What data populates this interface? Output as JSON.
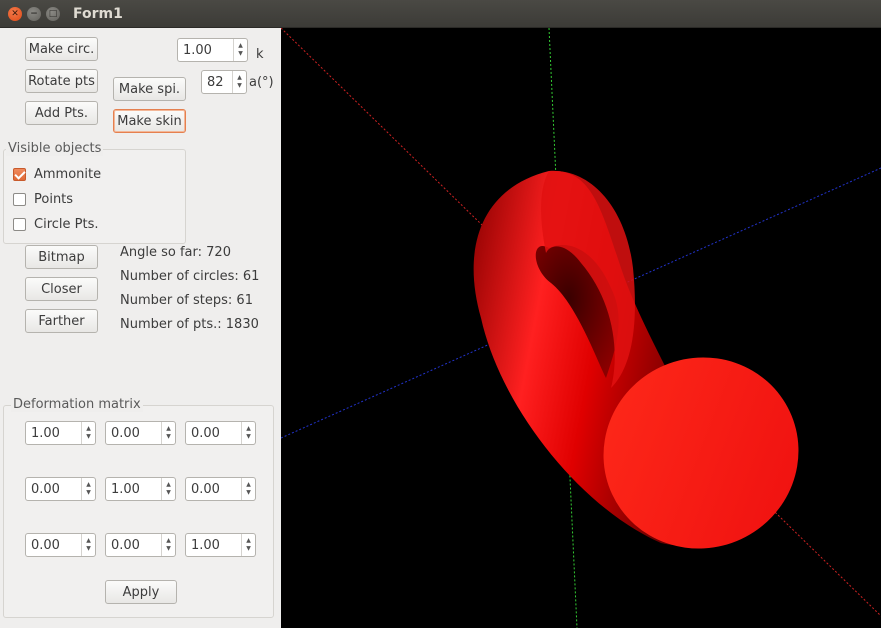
{
  "window": {
    "title": "Form1"
  },
  "buttons": {
    "make_circ": "Make circ.",
    "rotate_pts": "Rotate pts",
    "add_pts": "Add Pts.",
    "make_spi": "Make spi.",
    "make_skin": "Make skin",
    "bitmap": "Bitmap",
    "closer": "Closer",
    "farther": "Farther",
    "apply": "Apply"
  },
  "params": {
    "k_value": "1.00",
    "k_label": "k",
    "a_value": "82",
    "a_label": "a(°)"
  },
  "visible_objects": {
    "title": "Visible objects",
    "items": [
      {
        "label": "Ammonite",
        "checked": true
      },
      {
        "label": "Points",
        "checked": false
      },
      {
        "label": "Circle Pts.",
        "checked": false
      }
    ]
  },
  "stats": {
    "angle": "Angle so far: 720",
    "circles": "Number of circles: 61",
    "steps": "Number of steps: 61",
    "pts": "Number of pts.: 1830"
  },
  "deformation": {
    "title": "Deformation matrix",
    "rows": [
      [
        "1.00",
        "0.00",
        "0.00"
      ],
      [
        "0.00",
        "1.00",
        "0.00"
      ],
      [
        "0.00",
        "0.00",
        "1.00"
      ]
    ]
  },
  "colors": {
    "accent": "#e5804f",
    "shape": "#ff1a1a",
    "viewport_bg": "#000000",
    "axis_x": "#cc2222",
    "axis_y": "#33cc33",
    "axis_z": "#2233cc"
  }
}
